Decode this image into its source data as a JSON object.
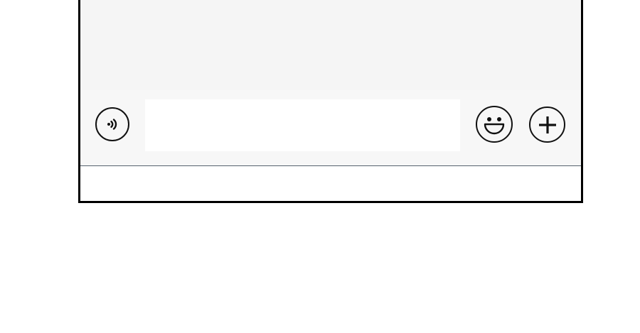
{
  "chat": {
    "messages": []
  },
  "input_bar": {
    "voice_button": {
      "icon": "voice-icon"
    },
    "message_input": {
      "value": "",
      "placeholder": ""
    },
    "emoji_button": {
      "icon": "smiley-icon"
    },
    "plus_button": {
      "icon": "plus-icon"
    }
  },
  "colors": {
    "frame_border": "#000000",
    "chat_background": "#f5f5f5",
    "input_background": "#ffffff",
    "divider": "#55626e"
  }
}
